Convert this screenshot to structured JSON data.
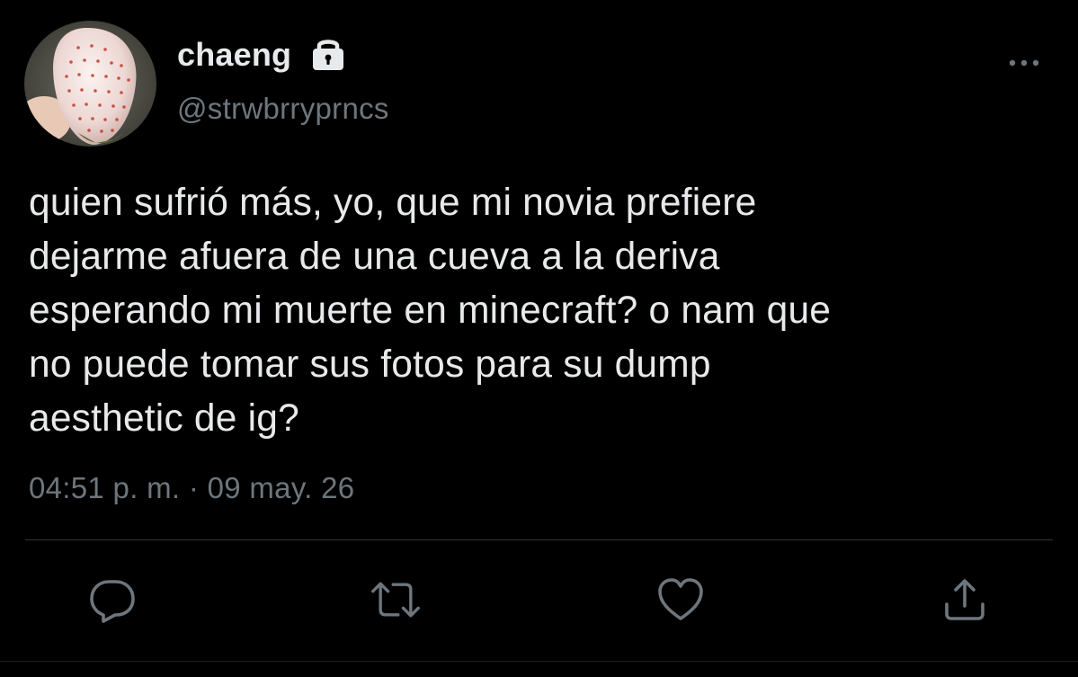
{
  "author": {
    "display_name": "chaeng",
    "handle": "@strwbrryprncs",
    "protected": true,
    "avatar": "white-strawberry-photo"
  },
  "tweet": {
    "text": "quien sufrió más, yo, que mi novia prefiere\ndejarme afuera de una cueva a la deriva\nesperando mi muerte en minecraft? o nam que\nno puede tomar sus fotos para su dump\naesthetic de ig?",
    "timestamp": "04:51 p. m. · 09 may. 26"
  },
  "actions": {
    "reply_icon": "reply-icon",
    "retweet_icon": "retweet-icon",
    "like_icon": "heart-icon",
    "share_icon": "share-icon",
    "more_icon": "more-icon"
  },
  "colors": {
    "background": "#000000",
    "primary_text": "#e7e9ea",
    "secondary_text": "#6e767d",
    "divider": "#2f3336",
    "icon": "#6e767d"
  }
}
